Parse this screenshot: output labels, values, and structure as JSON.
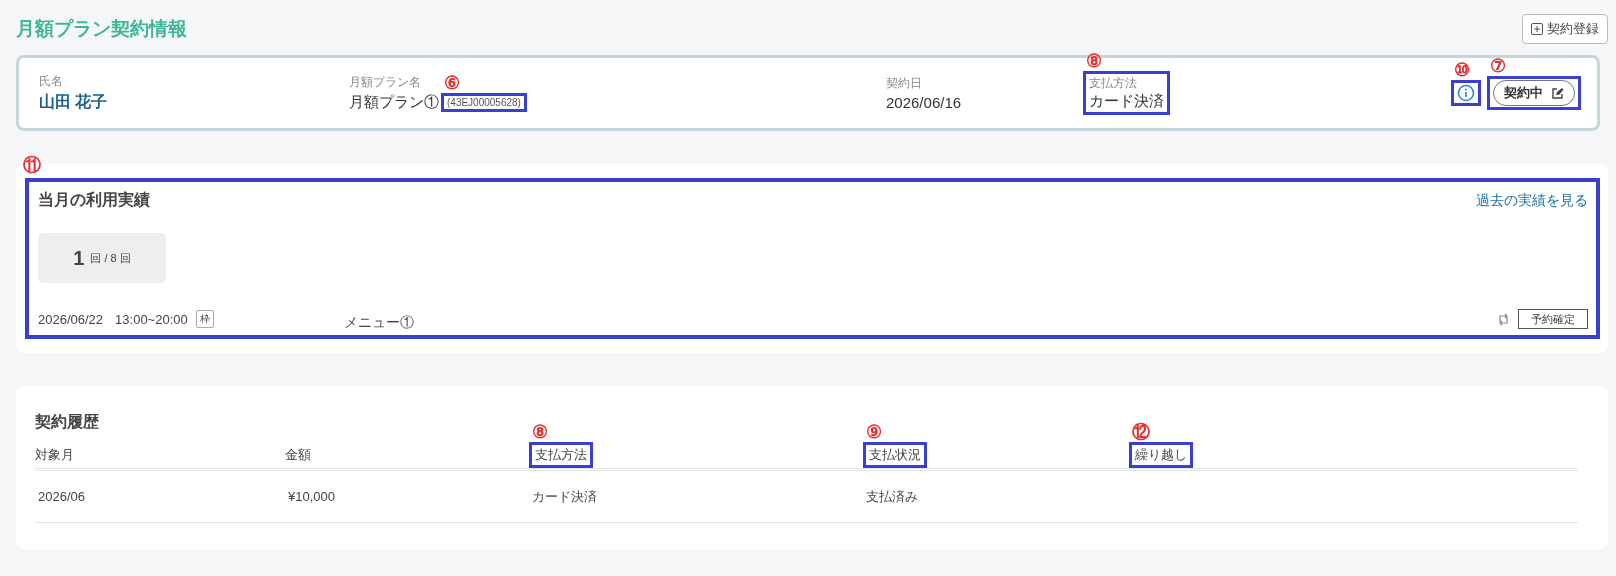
{
  "page_title": "月額プラン契約情報",
  "register_button": {
    "label": "契約登録"
  },
  "contract": {
    "fields": [
      {
        "kind": "name",
        "label": "氏名",
        "value": "山田 花子"
      },
      {
        "kind": "plan",
        "label": "月額プラン名",
        "value": "月額プラン①",
        "code": "(43EJ00005628)",
        "code_marker": "⑥"
      },
      {
        "kind": "plain",
        "label": "契約日",
        "value": "2026/06/16"
      },
      {
        "kind": "plain",
        "label": "支払方法",
        "value": "カード決済",
        "marker": "⑧"
      }
    ],
    "info_marker": "⑩",
    "status": {
      "label": "契約中",
      "marker": "⑦"
    }
  },
  "usage": {
    "marker": "⑪",
    "title": "当月の利用実績",
    "link": "過去の実績を見る",
    "count": {
      "used": "1",
      "rest": "回 / 8 回"
    },
    "reservations": [
      {
        "date": "2026/06/22",
        "time": "13:00~20:00",
        "tag": "枠",
        "menu": "メニュー①",
        "button": "予約確定"
      }
    ]
  },
  "history": {
    "title": "契約履歴",
    "columns": [
      {
        "label": "対象月"
      },
      {
        "label": "金額"
      },
      {
        "label": "支払方法",
        "marker": "⑧"
      },
      {
        "label": "支払状況",
        "marker": "⑨"
      },
      {
        "label": "繰り越し",
        "marker": "⑫"
      }
    ],
    "rows": [
      {
        "cells": [
          "2026/06",
          "¥10,000",
          "カード決済",
          "支払済み"
        ]
      }
    ]
  }
}
